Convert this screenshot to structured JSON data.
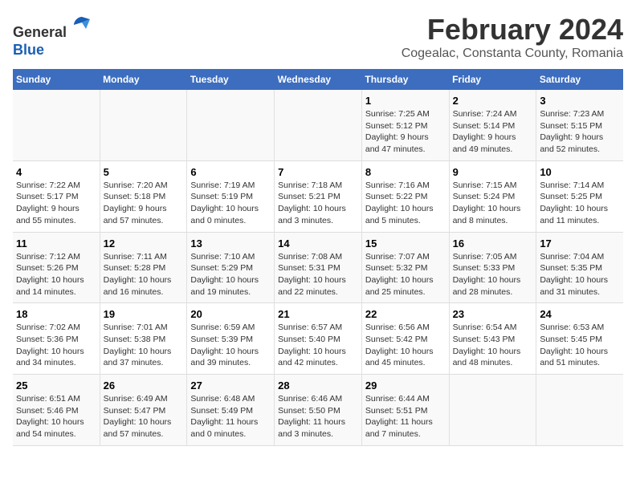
{
  "header": {
    "logo_line1": "General",
    "logo_line2": "Blue",
    "title": "February 2024",
    "subtitle": "Cogealac, Constanta County, Romania"
  },
  "columns": [
    "Sunday",
    "Monday",
    "Tuesday",
    "Wednesday",
    "Thursday",
    "Friday",
    "Saturday"
  ],
  "weeks": [
    [
      {
        "day": "",
        "info": ""
      },
      {
        "day": "",
        "info": ""
      },
      {
        "day": "",
        "info": ""
      },
      {
        "day": "",
        "info": ""
      },
      {
        "day": "1",
        "info": "Sunrise: 7:25 AM\nSunset: 5:12 PM\nDaylight: 9 hours\nand 47 minutes."
      },
      {
        "day": "2",
        "info": "Sunrise: 7:24 AM\nSunset: 5:14 PM\nDaylight: 9 hours\nand 49 minutes."
      },
      {
        "day": "3",
        "info": "Sunrise: 7:23 AM\nSunset: 5:15 PM\nDaylight: 9 hours\nand 52 minutes."
      }
    ],
    [
      {
        "day": "4",
        "info": "Sunrise: 7:22 AM\nSunset: 5:17 PM\nDaylight: 9 hours\nand 55 minutes."
      },
      {
        "day": "5",
        "info": "Sunrise: 7:20 AM\nSunset: 5:18 PM\nDaylight: 9 hours\nand 57 minutes."
      },
      {
        "day": "6",
        "info": "Sunrise: 7:19 AM\nSunset: 5:19 PM\nDaylight: 10 hours\nand 0 minutes."
      },
      {
        "day": "7",
        "info": "Sunrise: 7:18 AM\nSunset: 5:21 PM\nDaylight: 10 hours\nand 3 minutes."
      },
      {
        "day": "8",
        "info": "Sunrise: 7:16 AM\nSunset: 5:22 PM\nDaylight: 10 hours\nand 5 minutes."
      },
      {
        "day": "9",
        "info": "Sunrise: 7:15 AM\nSunset: 5:24 PM\nDaylight: 10 hours\nand 8 minutes."
      },
      {
        "day": "10",
        "info": "Sunrise: 7:14 AM\nSunset: 5:25 PM\nDaylight: 10 hours\nand 11 minutes."
      }
    ],
    [
      {
        "day": "11",
        "info": "Sunrise: 7:12 AM\nSunset: 5:26 PM\nDaylight: 10 hours\nand 14 minutes."
      },
      {
        "day": "12",
        "info": "Sunrise: 7:11 AM\nSunset: 5:28 PM\nDaylight: 10 hours\nand 16 minutes."
      },
      {
        "day": "13",
        "info": "Sunrise: 7:10 AM\nSunset: 5:29 PM\nDaylight: 10 hours\nand 19 minutes."
      },
      {
        "day": "14",
        "info": "Sunrise: 7:08 AM\nSunset: 5:31 PM\nDaylight: 10 hours\nand 22 minutes."
      },
      {
        "day": "15",
        "info": "Sunrise: 7:07 AM\nSunset: 5:32 PM\nDaylight: 10 hours\nand 25 minutes."
      },
      {
        "day": "16",
        "info": "Sunrise: 7:05 AM\nSunset: 5:33 PM\nDaylight: 10 hours\nand 28 minutes."
      },
      {
        "day": "17",
        "info": "Sunrise: 7:04 AM\nSunset: 5:35 PM\nDaylight: 10 hours\nand 31 minutes."
      }
    ],
    [
      {
        "day": "18",
        "info": "Sunrise: 7:02 AM\nSunset: 5:36 PM\nDaylight: 10 hours\nand 34 minutes."
      },
      {
        "day": "19",
        "info": "Sunrise: 7:01 AM\nSunset: 5:38 PM\nDaylight: 10 hours\nand 37 minutes."
      },
      {
        "day": "20",
        "info": "Sunrise: 6:59 AM\nSunset: 5:39 PM\nDaylight: 10 hours\nand 39 minutes."
      },
      {
        "day": "21",
        "info": "Sunrise: 6:57 AM\nSunset: 5:40 PM\nDaylight: 10 hours\nand 42 minutes."
      },
      {
        "day": "22",
        "info": "Sunrise: 6:56 AM\nSunset: 5:42 PM\nDaylight: 10 hours\nand 45 minutes."
      },
      {
        "day": "23",
        "info": "Sunrise: 6:54 AM\nSunset: 5:43 PM\nDaylight: 10 hours\nand 48 minutes."
      },
      {
        "day": "24",
        "info": "Sunrise: 6:53 AM\nSunset: 5:45 PM\nDaylight: 10 hours\nand 51 minutes."
      }
    ],
    [
      {
        "day": "25",
        "info": "Sunrise: 6:51 AM\nSunset: 5:46 PM\nDaylight: 10 hours\nand 54 minutes."
      },
      {
        "day": "26",
        "info": "Sunrise: 6:49 AM\nSunset: 5:47 PM\nDaylight: 10 hours\nand 57 minutes."
      },
      {
        "day": "27",
        "info": "Sunrise: 6:48 AM\nSunset: 5:49 PM\nDaylight: 11 hours\nand 0 minutes."
      },
      {
        "day": "28",
        "info": "Sunrise: 6:46 AM\nSunset: 5:50 PM\nDaylight: 11 hours\nand 3 minutes."
      },
      {
        "day": "29",
        "info": "Sunrise: 6:44 AM\nSunset: 5:51 PM\nDaylight: 11 hours\nand 7 minutes."
      },
      {
        "day": "",
        "info": ""
      },
      {
        "day": "",
        "info": ""
      }
    ]
  ]
}
